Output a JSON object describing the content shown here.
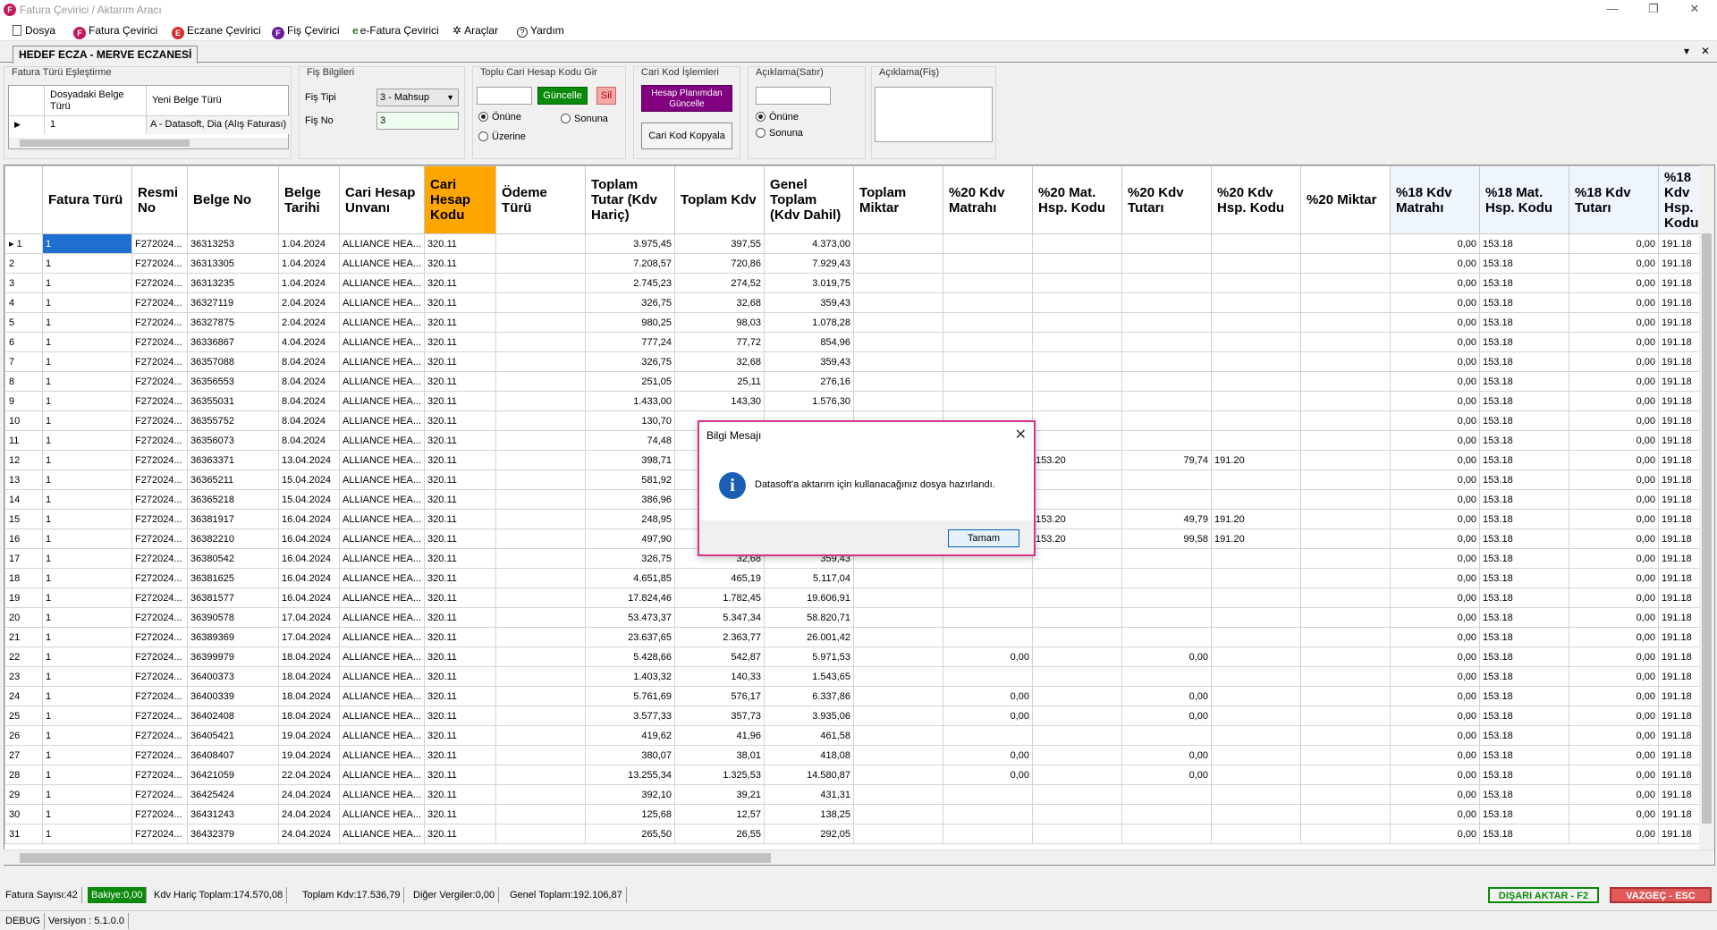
{
  "window": {
    "title": "Fatura Çevirici / Aktarım Aracı",
    "app_icon": "F",
    "minimize": "—",
    "maximize": "❐",
    "close": "✕"
  },
  "menu": [
    {
      "label": "Dosya",
      "icon": "document-icon"
    },
    {
      "label": "Fatura Çevirici",
      "icon": "F"
    },
    {
      "label": "Eczane Çevirici",
      "icon": "E"
    },
    {
      "label": "Fiş Çevirici",
      "icon": "F"
    },
    {
      "label": "e-Fatura Çevirici",
      "icon": "e"
    },
    {
      "label": "Araçlar",
      "icon": "tools-icon"
    },
    {
      "label": "Yardım",
      "icon": "help-icon"
    }
  ],
  "tab": {
    "label": "HEDEF ECZA - MERVE ECZANESİ",
    "menu_glyph": "▾",
    "close_glyph": "✕"
  },
  "fatura_turu": {
    "group_label": "Fatura Türü Eşleştirme",
    "col1": "Dosyadaki Belge Türü",
    "col2": "Yeni Belge Türü",
    "row_value": "1",
    "row_type": "A - Datasoft, Dia (Alış Faturası)"
  },
  "fis_bilgileri": {
    "group_label": "Fiş Bilgileri",
    "fis_tipi_label": "Fiş Tipi",
    "fis_tipi_value": "3 - Mahsup",
    "fis_no_label": "Fiş No",
    "fis_no_value": "3"
  },
  "toplu_cari": {
    "group_label": "Toplu Cari Hesap Kodu Gir",
    "input_value": "",
    "guncelle": "Güncelle",
    "sil": "Sil",
    "radio_onune": "Önüne",
    "radio_sonuna": "Sonuna",
    "radio_uzerine": "Üzerine"
  },
  "cari_kod": {
    "group_label": "Cari Kod İşlemleri",
    "hesap_plani_btn": "Hesap Planımdan Güncelle",
    "kopyala_btn": "Cari Kod Kopyala"
  },
  "aciklama_satir": {
    "group_label": "Açıklama(Satır)",
    "input_value": "",
    "radio_onune": "Önüne",
    "radio_sonuna": "Sonuna"
  },
  "aciklama_fis": {
    "group_label": "Açıklama(Fiş)",
    "input_value": ""
  },
  "grid": {
    "columns": [
      "Fatura Türü",
      "Resmi No",
      "Belge No",
      "Belge Tarihi",
      "Cari Hesap Unvanı",
      "Cari Hesap Kodu",
      "Ödeme Türü",
      "Toplam Tutar (Kdv Hariç)",
      "Toplam Kdv",
      "Genel Toplam (Kdv Dahil)",
      "Toplam Miktar",
      "%20 Kdv Matrahı",
      "%20 Mat. Hsp. Kodu",
      "%20 Kdv Tutarı",
      "%20 Kdv Hsp. Kodu",
      "%20 Miktar",
      "%18 Kdv Matrahı",
      "%18 Mat. Hsp. Kodu",
      "%18 Kdv Tutarı",
      "%18 Kdv Hsp. Kodu"
    ],
    "rows": [
      [
        "1",
        "1",
        "F272024...",
        "36313253",
        "1.04.2024",
        "ALLIANCE HEA...",
        "320.11",
        "",
        "3.975,45",
        "397,55",
        "4.373,00",
        "",
        "",
        "",
        "",
        "",
        "",
        "0,00",
        "153.18",
        "0,00",
        "191.18"
      ],
      [
        "2",
        "1",
        "F272024...",
        "36313305",
        "1.04.2024",
        "ALLIANCE HEA...",
        "320.11",
        "",
        "7.208,57",
        "720,86",
        "7.929,43",
        "",
        "",
        "",
        "",
        "",
        "",
        "0,00",
        "153.18",
        "0,00",
        "191.18"
      ],
      [
        "3",
        "1",
        "F272024...",
        "36313235",
        "1.04.2024",
        "ALLIANCE HEA...",
        "320.11",
        "",
        "2.745,23",
        "274,52",
        "3.019,75",
        "",
        "",
        "",
        "",
        "",
        "",
        "0,00",
        "153.18",
        "0,00",
        "191.18"
      ],
      [
        "4",
        "1",
        "F272024...",
        "36327119",
        "2.04.2024",
        "ALLIANCE HEA...",
        "320.11",
        "",
        "326,75",
        "32,68",
        "359,43",
        "",
        "",
        "",
        "",
        "",
        "",
        "0,00",
        "153.18",
        "0,00",
        "191.18"
      ],
      [
        "5",
        "1",
        "F272024...",
        "36327875",
        "2.04.2024",
        "ALLIANCE HEA...",
        "320.11",
        "",
        "980,25",
        "98,03",
        "1.078,28",
        "",
        "",
        "",
        "",
        "",
        "",
        "0,00",
        "153.18",
        "0,00",
        "191.18"
      ],
      [
        "6",
        "1",
        "F272024...",
        "36336867",
        "4.04.2024",
        "ALLIANCE HEA...",
        "320.11",
        "",
        "777,24",
        "77,72",
        "854,96",
        "",
        "",
        "",
        "",
        "",
        "",
        "0,00",
        "153.18",
        "0,00",
        "191.18"
      ],
      [
        "7",
        "1",
        "F272024...",
        "36357088",
        "8.04.2024",
        "ALLIANCE HEA...",
        "320.11",
        "",
        "326,75",
        "32,68",
        "359,43",
        "",
        "",
        "",
        "",
        "",
        "",
        "0,00",
        "153.18",
        "0,00",
        "191.18"
      ],
      [
        "8",
        "1",
        "F272024...",
        "36356553",
        "8.04.2024",
        "ALLIANCE HEA...",
        "320.11",
        "",
        "251,05",
        "25,11",
        "276,16",
        "",
        "",
        "",
        "",
        "",
        "",
        "0,00",
        "153.18",
        "0,00",
        "191.18"
      ],
      [
        "9",
        "1",
        "F272024...",
        "36355031",
        "8.04.2024",
        "ALLIANCE HEA...",
        "320.11",
        "",
        "1.433,00",
        "143,30",
        "1.576,30",
        "",
        "",
        "",
        "",
        "",
        "",
        "0,00",
        "153.18",
        "0,00",
        "191.18"
      ],
      [
        "10",
        "1",
        "F272024...",
        "36355752",
        "8.04.2024",
        "ALLIANCE HEA...",
        "320.11",
        "",
        "130,70",
        "",
        "",
        "",
        "",
        "",
        "",
        "",
        "",
        "0,00",
        "153.18",
        "0,00",
        "191.18"
      ],
      [
        "11",
        "1",
        "F272024...",
        "36356073",
        "8.04.2024",
        "ALLIANCE HEA...",
        "320.11",
        "",
        "74,48",
        "",
        "",
        "",
        "",
        "",
        "",
        "",
        "",
        "0,00",
        "153.18",
        "0,00",
        "191.18"
      ],
      [
        "12",
        "1",
        "F272024...",
        "36363371",
        "13.04.2024",
        "ALLIANCE HEA...",
        "320.11",
        "",
        "398,71",
        "",
        "",
        "",
        "",
        "153.20",
        "79,74",
        "191.20",
        "",
        "0,00",
        "153.18",
        "0,00",
        "191.18"
      ],
      [
        "13",
        "1",
        "F272024...",
        "36365211",
        "15.04.2024",
        "ALLIANCE HEA...",
        "320.11",
        "",
        "581,92",
        "",
        "",
        "",
        "",
        "",
        "",
        "",
        "",
        "0,00",
        "153.18",
        "0,00",
        "191.18"
      ],
      [
        "14",
        "1",
        "F272024...",
        "36365218",
        "15.04.2024",
        "ALLIANCE HEA...",
        "320.11",
        "",
        "386,96",
        "",
        "",
        "",
        "",
        "",
        "",
        "",
        "",
        "0,00",
        "153.18",
        "0,00",
        "191.18"
      ],
      [
        "15",
        "1",
        "F272024...",
        "36381917",
        "16.04.2024",
        "ALLIANCE HEA...",
        "320.11",
        "",
        "248,95",
        "",
        "",
        "",
        "",
        "153.20",
        "49,79",
        "191.20",
        "",
        "0,00",
        "153.18",
        "0,00",
        "191.18"
      ],
      [
        "16",
        "1",
        "F272024...",
        "36382210",
        "16.04.2024",
        "ALLIANCE HEA...",
        "320.11",
        "",
        "497,90",
        "",
        "",
        "",
        "",
        "153.20",
        "99,58",
        "191.20",
        "",
        "0,00",
        "153.18",
        "0,00",
        "191.18"
      ],
      [
        "17",
        "1",
        "F272024...",
        "36380542",
        "16.04.2024",
        "ALLIANCE HEA...",
        "320.11",
        "",
        "326,75",
        "32,68",
        "359,43",
        "",
        "",
        "",
        "",
        "",
        "",
        "0,00",
        "153.18",
        "0,00",
        "191.18"
      ],
      [
        "18",
        "1",
        "F272024...",
        "36381625",
        "16.04.2024",
        "ALLIANCE HEA...",
        "320.11",
        "",
        "4.651,85",
        "465,19",
        "5.117,04",
        "",
        "",
        "",
        "",
        "",
        "",
        "0,00",
        "153.18",
        "0,00",
        "191.18"
      ],
      [
        "19",
        "1",
        "F272024...",
        "36381577",
        "16.04.2024",
        "ALLIANCE HEA...",
        "320.11",
        "",
        "17.824,46",
        "1.782,45",
        "19.606,91",
        "",
        "",
        "",
        "",
        "",
        "",
        "0,00",
        "153.18",
        "0,00",
        "191.18"
      ],
      [
        "20",
        "1",
        "F272024...",
        "36390578",
        "17.04.2024",
        "ALLIANCE HEA...",
        "320.11",
        "",
        "53.473,37",
        "5.347,34",
        "58.820,71",
        "",
        "",
        "",
        "",
        "",
        "",
        "0,00",
        "153.18",
        "0,00",
        "191.18"
      ],
      [
        "21",
        "1",
        "F272024...",
        "36389369",
        "17.04.2024",
        "ALLIANCE HEA...",
        "320.11",
        "",
        "23.637,65",
        "2.363,77",
        "26.001,42",
        "",
        "",
        "",
        "",
        "",
        "",
        "0,00",
        "153.18",
        "0,00",
        "191.18"
      ],
      [
        "22",
        "1",
        "F272024...",
        "36399979",
        "18.04.2024",
        "ALLIANCE HEA...",
        "320.11",
        "",
        "5.428,66",
        "542,87",
        "5.971,53",
        "",
        "0,00",
        "",
        "0,00",
        "",
        "",
        "0,00",
        "153.18",
        "0,00",
        "191.18"
      ],
      [
        "23",
        "1",
        "F272024...",
        "36400373",
        "18.04.2024",
        "ALLIANCE HEA...",
        "320.11",
        "",
        "1.403,32",
        "140,33",
        "1.543,65",
        "",
        "",
        "",
        "",
        "",
        "",
        "0,00",
        "153.18",
        "0,00",
        "191.18"
      ],
      [
        "24",
        "1",
        "F272024...",
        "36400339",
        "18.04.2024",
        "ALLIANCE HEA...",
        "320.11",
        "",
        "5.761,69",
        "576,17",
        "6.337,86",
        "",
        "0,00",
        "",
        "0,00",
        "",
        "",
        "0,00",
        "153.18",
        "0,00",
        "191.18"
      ],
      [
        "25",
        "1",
        "F272024...",
        "36402408",
        "18.04.2024",
        "ALLIANCE HEA...",
        "320.11",
        "",
        "3.577,33",
        "357,73",
        "3.935,06",
        "",
        "0,00",
        "",
        "0,00",
        "",
        "",
        "0,00",
        "153.18",
        "0,00",
        "191.18"
      ],
      [
        "26",
        "1",
        "F272024...",
        "36405421",
        "19.04.2024",
        "ALLIANCE HEA...",
        "320.11",
        "",
        "419,62",
        "41,96",
        "461,58",
        "",
        "",
        "",
        "",
        "",
        "",
        "0,00",
        "153.18",
        "0,00",
        "191.18"
      ],
      [
        "27",
        "1",
        "F272024...",
        "36408407",
        "19.04.2024",
        "ALLIANCE HEA...",
        "320.11",
        "",
        "380,07",
        "38,01",
        "418,08",
        "",
        "0,00",
        "",
        "0,00",
        "",
        "",
        "0,00",
        "153.18",
        "0,00",
        "191.18"
      ],
      [
        "28",
        "1",
        "F272024...",
        "36421059",
        "22.04.2024",
        "ALLIANCE HEA...",
        "320.11",
        "",
        "13.255,34",
        "1.325,53",
        "14.580,87",
        "",
        "0,00",
        "",
        "0,00",
        "",
        "",
        "0,00",
        "153.18",
        "0,00",
        "191.18"
      ],
      [
        "29",
        "1",
        "F272024...",
        "36425424",
        "24.04.2024",
        "ALLIANCE HEA...",
        "320.11",
        "",
        "392,10",
        "39,21",
        "431,31",
        "",
        "",
        "",
        "",
        "",
        "",
        "0,00",
        "153.18",
        "0,00",
        "191.18"
      ],
      [
        "30",
        "1",
        "F272024...",
        "36431243",
        "24.04.2024",
        "ALLIANCE HEA...",
        "320.11",
        "",
        "125,68",
        "12,57",
        "138,25",
        "",
        "",
        "",
        "",
        "",
        "",
        "0,00",
        "153.18",
        "0,00",
        "191.18"
      ],
      [
        "31",
        "1",
        "F272024...",
        "36432379",
        "24.04.2024",
        "ALLIANCE HEA...",
        "320.11",
        "",
        "265,50",
        "26,55",
        "292,05",
        "",
        "",
        "",
        "",
        "",
        "",
        "0,00",
        "153.18",
        "0,00",
        "191.18"
      ]
    ]
  },
  "status": {
    "fatura_sayisi": "Fatura Sayısı:42",
    "bakiye": "Bakiye:0,00",
    "kdv_haric": "Kdv Hariç Toplam:174.570,08",
    "toplam_kdv": "Toplam Kdv:17.536,79",
    "diger_vergiler": "Diğer Vergiler:0,00",
    "genel_toplam": "Genel Toplam:192.106,87",
    "disari_aktar": "DIŞARI AKTAR - F2",
    "vazgec": "VAZGEÇ - ESC"
  },
  "debug": {
    "mode": "DEBUG",
    "version": "Versiyon : 5.1.0.0"
  },
  "dialog": {
    "title": "Bilgi Mesajı",
    "message": "Datasoft'a aktarım için kullanacağınız dosya hazırlandı.",
    "ok": "Tamam",
    "icon": "i",
    "close": "✕"
  },
  "colors": {
    "accent_orange": "#ffa500",
    "green": "#0a8a0a",
    "purple": "#800080",
    "red": "#e05a5a",
    "dialog_border": "#d6338a",
    "selection": "#1e6fd0"
  }
}
